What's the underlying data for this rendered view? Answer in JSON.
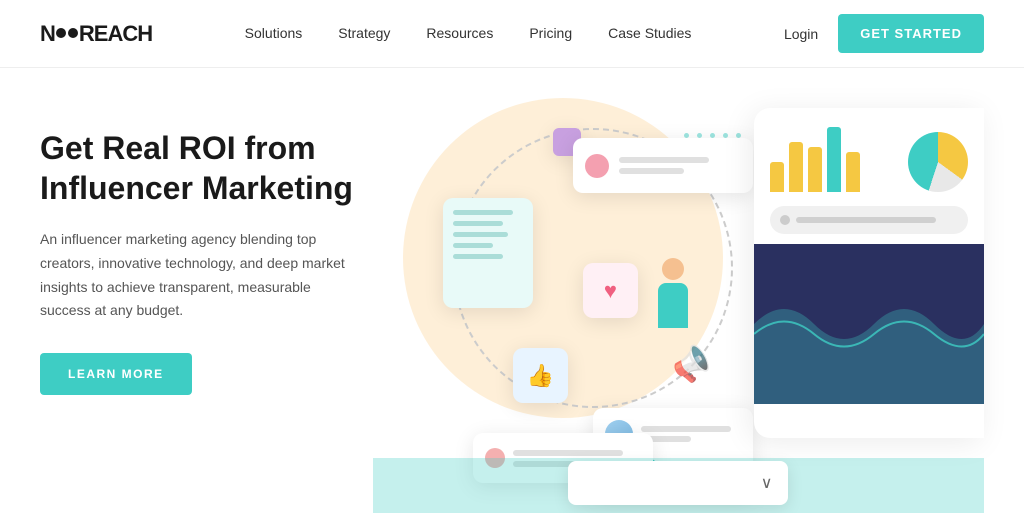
{
  "logo": {
    "text_before": "N",
    "text_after": "REACH",
    "brand": "NEOREACH"
  },
  "navbar": {
    "links": [
      {
        "label": "Solutions",
        "id": "solutions"
      },
      {
        "label": "Strategy",
        "id": "strategy"
      },
      {
        "label": "Resources",
        "id": "resources"
      },
      {
        "label": "Pricing",
        "id": "pricing"
      },
      {
        "label": "Case Studies",
        "id": "case-studies"
      }
    ],
    "login_label": "Login",
    "cta_label": "GET STARTED"
  },
  "hero": {
    "title": "Get Real ROI from\nInfluencer Marketing",
    "subtitle": "An influencer marketing agency blending top creators, innovative technology, and deep market insights to achieve transparent, measurable success at any budget.",
    "cta_label": "LEARN MORE"
  },
  "colors": {
    "teal": "#3ecdc4",
    "dark_navy": "#2a3060",
    "orange_circle": "#fde8c8",
    "text_dark": "#1a1a1a",
    "text_mid": "#555555"
  },
  "bars": [
    {
      "height": 30,
      "color": "#f5c842"
    },
    {
      "height": 50,
      "color": "#f5c842"
    },
    {
      "height": 45,
      "color": "#f5c842"
    },
    {
      "height": 65,
      "color": "#3ecdc4"
    },
    {
      "height": 40,
      "color": "#f5c842"
    }
  ],
  "profile_dots": [
    {
      "color": "#f06080"
    },
    {
      "color": "#f5c842"
    },
    {
      "color": "#3ecdc4"
    }
  ],
  "dropdown": {
    "placeholder": ""
  }
}
